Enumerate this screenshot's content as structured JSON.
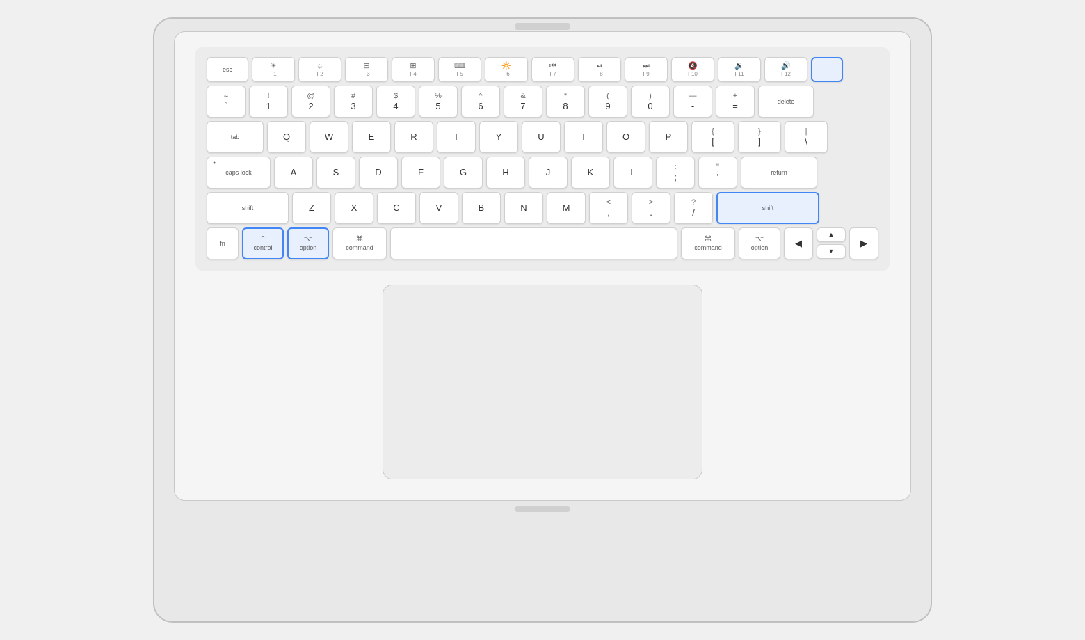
{
  "keyboard": {
    "rows": {
      "fkeys": [
        {
          "id": "esc",
          "label": "esc",
          "class": "key-esc"
        },
        {
          "id": "f1",
          "symbol": "☀",
          "sublabel": "F1",
          "class": "key-f"
        },
        {
          "id": "f2",
          "symbol": "☀",
          "sublabel": "F2",
          "class": "key-f"
        },
        {
          "id": "f3",
          "symbol": "⊞",
          "sublabel": "F3",
          "class": "key-f"
        },
        {
          "id": "f4",
          "symbol": "⊞⊞",
          "sublabel": "F4",
          "class": "key-f"
        },
        {
          "id": "f5",
          "symbol": "·",
          "sublabel": "F5",
          "class": "key-f"
        },
        {
          "id": "f6",
          "symbol": "·↑",
          "sublabel": "F6",
          "class": "key-f"
        },
        {
          "id": "f7",
          "symbol": "⏮",
          "sublabel": "F7",
          "class": "key-f"
        },
        {
          "id": "f8",
          "symbol": "⏯",
          "sublabel": "F8",
          "class": "key-f"
        },
        {
          "id": "f9",
          "symbol": "⏭",
          "sublabel": "F9",
          "class": "key-f"
        },
        {
          "id": "f10",
          "symbol": "◁",
          "sublabel": "F10",
          "class": "key-f"
        },
        {
          "id": "f11",
          "symbol": "◁)",
          "sublabel": "F11",
          "class": "key-f"
        },
        {
          "id": "f12",
          "symbol": "◁))",
          "sublabel": "F12",
          "class": "key-f"
        },
        {
          "id": "power",
          "symbol": "",
          "sublabel": "",
          "class": "key-power",
          "highlighted": true
        }
      ],
      "numbers": [
        {
          "id": "tilde",
          "top": "~",
          "bottom": "`",
          "class": "key-std"
        },
        {
          "id": "1",
          "top": "!",
          "bottom": "1",
          "class": "key-std"
        },
        {
          "id": "2",
          "top": "@",
          "bottom": "2",
          "class": "key-std"
        },
        {
          "id": "3",
          "top": "#",
          "bottom": "3",
          "class": "key-std"
        },
        {
          "id": "4",
          "top": "$",
          "bottom": "4",
          "class": "key-std"
        },
        {
          "id": "5",
          "top": "%",
          "bottom": "5",
          "class": "key-std"
        },
        {
          "id": "6",
          "top": "^",
          "bottom": "6",
          "class": "key-std"
        },
        {
          "id": "7",
          "top": "&",
          "bottom": "7",
          "class": "key-std"
        },
        {
          "id": "8",
          "top": "*",
          "bottom": "8",
          "class": "key-std"
        },
        {
          "id": "9",
          "top": "(",
          "bottom": "9",
          "class": "key-std"
        },
        {
          "id": "0",
          "top": ")",
          "bottom": "0",
          "class": "key-std"
        },
        {
          "id": "minus",
          "top": "—",
          "bottom": "-",
          "class": "key-std"
        },
        {
          "id": "equals",
          "top": "+",
          "bottom": "=",
          "class": "key-std"
        },
        {
          "id": "delete",
          "label": "delete",
          "class": "key-delete"
        }
      ],
      "qwerty": [
        "Q",
        "W",
        "E",
        "R",
        "T",
        "Y",
        "U",
        "I",
        "O",
        "P"
      ],
      "asdf": [
        "A",
        "S",
        "D",
        "F",
        "G",
        "H",
        "J",
        "K",
        "L"
      ],
      "zxcv": [
        "Z",
        "X",
        "C",
        "V",
        "B",
        "N",
        "M"
      ]
    },
    "highlighted_keys": [
      "control",
      "option-l",
      "shift-r",
      "power"
    ],
    "labels": {
      "esc": "esc",
      "tab": "tab",
      "caps_lock": "caps lock",
      "shift_l": "shift",
      "shift_r": "shift",
      "fn": "fn",
      "control": "control",
      "option_l": "option",
      "command_l": "command",
      "command_r": "command",
      "option_r": "option",
      "return": "return",
      "delete": "delete"
    }
  }
}
